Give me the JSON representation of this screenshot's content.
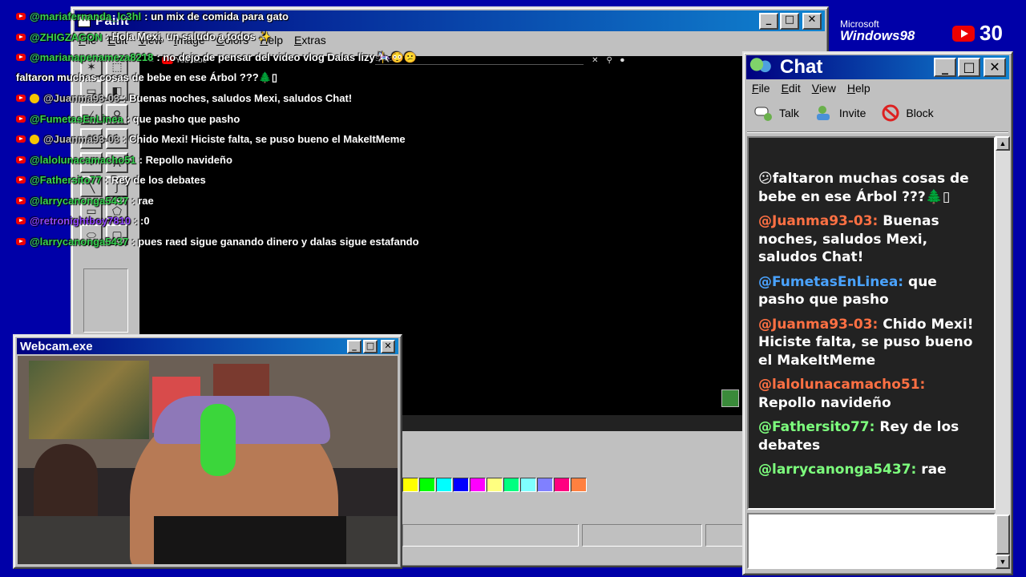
{
  "colors": {
    "desktop": "#0000a8",
    "title_active": "#000080",
    "chat_bg": "#222222",
    "user_orange": "#ff7043",
    "user_blue": "#4aa3ff",
    "user_green": "#7dff7d",
    "overlay_green": "#39d353",
    "overlay_purple": "#9146ff"
  },
  "paint": {
    "title": "Paint",
    "menu": [
      "File",
      "Edit",
      "View",
      "Image",
      "Colors",
      "Help",
      "Extras"
    ],
    "youtube": {
      "logo": "YouTube",
      "search_placeholder": "Search"
    },
    "palette": [
      "#ffff00",
      "#00ff00",
      "#00ffff",
      "#0000ff",
      "#ff00ff",
      "#ffff80",
      "#00ff80",
      "#80ffff",
      "#8080ff",
      "#ff0080",
      "#ff8040"
    ]
  },
  "overlay_chat": [
    {
      "icon": "youtube",
      "user": "@mariafernanda_lc3hl",
      "color": "#39d353",
      "text": ": un mix de comida para gato"
    },
    {
      "icon": "youtube",
      "user": "@ZHIGZAGON",
      "color": "#39d353",
      "text": ": Hola Mexi, un saludo a todos ✨"
    },
    {
      "icon": "youtube",
      "user": "@marianapenameza8218",
      "color": "#39d353",
      "text": ": no dejo de pensar del video vlog Dalas lizy 🎠😳😕"
    },
    {
      "icon": "none",
      "user": "",
      "color": "#ffffff",
      "text": "faltaron muchas cosas de bebe en ese Árbol ???🌲▯"
    },
    {
      "icon": "mod",
      "user": "@Juanma93-03",
      "color": "#c0c0c0",
      "text": ": Buenas noches, saludos Mexi, saludos Chat!"
    },
    {
      "icon": "youtube",
      "user": "@FumetasEnLinea",
      "color": "#39d353",
      "text": ": que pasho que pasho"
    },
    {
      "icon": "mod",
      "user": "@Juanma93-03",
      "color": "#c0c0c0",
      "text": ": Chido Mexi! Hiciste falta, se puso bueno el MakeItMeme"
    },
    {
      "icon": "youtube",
      "user": "@lalolunacamacho51",
      "color": "#39d353",
      "text": ": Repollo navideño"
    },
    {
      "icon": "youtube",
      "user": "@Fathersito77",
      "color": "#39d353",
      "text": ": Rey de los debates"
    },
    {
      "icon": "youtube",
      "user": "@larrycanonga5437",
      "color": "#39d353",
      "text": ": rae"
    },
    {
      "icon": "youtube",
      "user": "@retronightboy7810",
      "color": "#9146ff",
      "text": ": :0"
    },
    {
      "icon": "youtube",
      "user": "@larrycanonga5437",
      "color": "#39d353",
      "text": ": pues raed sigue ganando dinero y dalas sigue estafando"
    }
  ],
  "webcam": {
    "title": "Webcam.exe"
  },
  "chat": {
    "title": "Chat",
    "menu": [
      "File",
      "Edit",
      "View",
      "Help"
    ],
    "toolbar": [
      {
        "label": "Talk",
        "icon": "talk-icon"
      },
      {
        "label": "Invite",
        "icon": "invite-icon"
      },
      {
        "label": "Block",
        "icon": "block-icon"
      }
    ],
    "messages": [
      {
        "user": "",
        "color": "#ffffff",
        "text": "😕faltaron muchas cosas de bebe en ese Árbol ???🌲▯"
      },
      {
        "user": "@Juanma93-03:",
        "color": "#ff7043",
        "text": "Buenas noches, saludos Mexi, saludos Chat!"
      },
      {
        "user": "@FumetasEnLinea:",
        "color": "#4aa3ff",
        "text": "que pasho que pasho"
      },
      {
        "user": "@Juanma93-03:",
        "color": "#ff7043",
        "text": "Chido Mexi! Hiciste falta, se puso bueno el MakeItMeme"
      },
      {
        "user": "@lalolunacamacho51:",
        "color": "#ff7043",
        "text": "Repollo navideño"
      },
      {
        "user": "@Fathersito77:",
        "color": "#7dff7d",
        "text": "Rey de los debates"
      },
      {
        "user": "@larrycanonga5437:",
        "color": "#7dff7d",
        "text": "rae"
      }
    ]
  },
  "branding": {
    "microsoft": "Microsoft",
    "windows": "Windows98"
  },
  "subscribers": {
    "count": "30"
  }
}
